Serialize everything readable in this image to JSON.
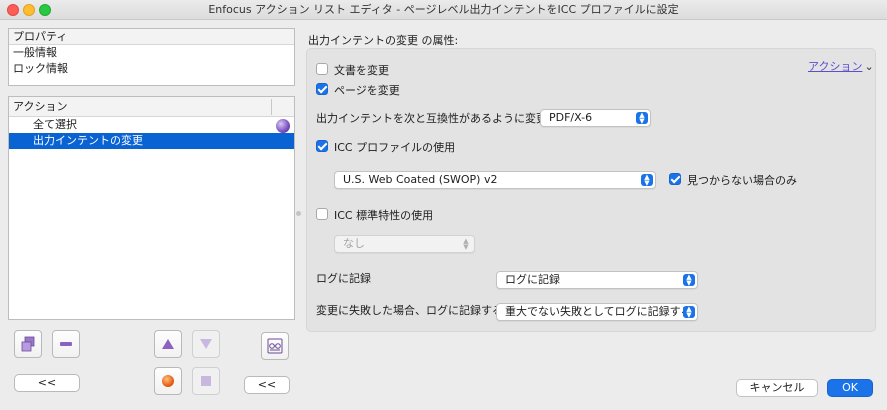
{
  "window": {
    "title": "Enfocus アクション リスト エディタ - ページレベル出力インテントをICC プロファイルに設定"
  },
  "properties_panel": {
    "header": "プロパティ",
    "items": [
      "一般情報",
      "ロック情報"
    ]
  },
  "actions_panel": {
    "header": "アクション",
    "items": [
      {
        "label": "全て選択",
        "selected": false
      },
      {
        "label": "出力インテントの変更",
        "selected": true
      }
    ]
  },
  "left_buttons": {
    "collapse_label": "<<",
    "collapse2_label": "<<"
  },
  "settings": {
    "title": "出力インテントの変更 の属性:",
    "actions_link": "アクション",
    "change_document_label": "文書を変更",
    "change_document_checked": false,
    "change_page_label": "ページを変更",
    "change_page_checked": true,
    "compat_label": "出力インテントを次と互換性があるように変更:",
    "compat_value": "PDF/X-6",
    "use_icc_label": "ICC プロファイルの使用",
    "use_icc_checked": true,
    "icc_value": "U.S. Web Coated (SWOP) v2",
    "only_if_missing_label": "見つからない場合のみ",
    "only_if_missing_checked": true,
    "use_icc_standard_label": "ICC 標準特性の使用",
    "use_icc_standard_checked": false,
    "icc_standard_value": "なし",
    "log_label": "ログに記録",
    "log_value": "ログに記録",
    "fail_label": "変更に失敗した場合、ログに記録する",
    "fail_value": "重大でない失敗としてログに記録する"
  },
  "dialog_buttons": {
    "cancel": "キャンセル",
    "ok": "OK"
  },
  "colors": {
    "accent": "#1a73e8",
    "selection": "#0a63d3"
  }
}
